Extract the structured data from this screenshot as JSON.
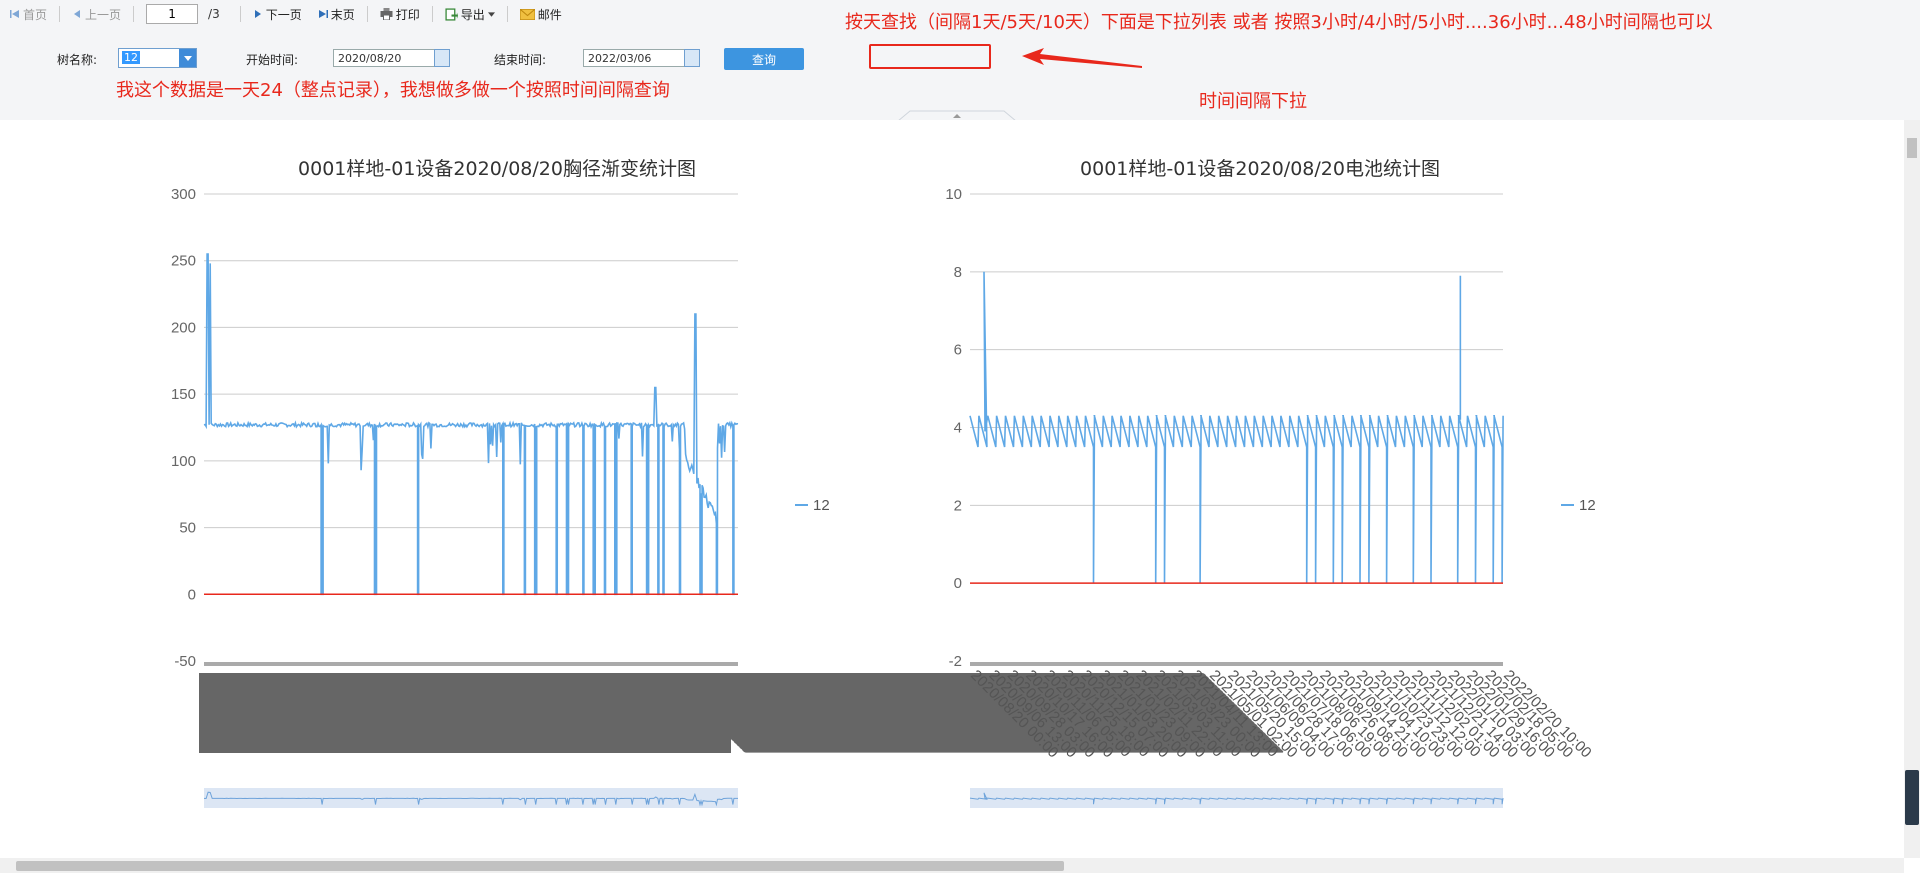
{
  "toolbar": {
    "first": "首页",
    "prev": "上一页",
    "page_value": "1",
    "page_total": "/3",
    "next": "下一页",
    "last": "末页",
    "print": "打印",
    "export": "导出",
    "mail": "邮件"
  },
  "query": {
    "tree_label": "树名称:",
    "tree_value": "12",
    "start_label": "开始时间:",
    "start_value": "2020/08/20",
    "end_label": "结束时间:",
    "end_value": "2022/03/06",
    "query_button": "查询"
  },
  "annotations": {
    "note_top": "按天查找（间隔1天/5天/10天）下面是下拉列表   或者 按照3小时/4小时/5小时....36小时...48小时间隔也可以",
    "note_left": "我这个数据是一天24（整点记录），我想做多做一个按照时间间隔查询",
    "note_right": "时间间隔下拉",
    "arrow_color": "#e8281c"
  },
  "chart_data": [
    {
      "type": "line",
      "title": "0001样地-01设备2020/08/20胸径渐变统计图",
      "ylim": [
        -50,
        300
      ],
      "y_ticks": [
        "300",
        "250",
        "200",
        "150",
        "100",
        "50",
        "0",
        "-50"
      ],
      "series": [
        {
          "name": "12",
          "color": "#5fa8e6"
        }
      ],
      "reference_line": {
        "y": 0,
        "color": "#e8281c"
      },
      "baseline_level": 127,
      "spikes": [
        255,
        248,
        210,
        155
      ],
      "legend": "right"
    },
    {
      "type": "line",
      "title": "0001样地-01设备2020/08/20电池统计图",
      "ylim": [
        -2,
        10
      ],
      "y_ticks": [
        "10",
        "8",
        "6",
        "4",
        "2",
        "0",
        "-2"
      ],
      "series": [
        {
          "name": "12",
          "color": "#5fa8e6"
        }
      ],
      "reference_line": {
        "y": 0,
        "color": "#e8281c"
      },
      "baseline_level": 4,
      "spikes": [
        8,
        7.9
      ],
      "x_ticks": [
        "2020/08/20 00:00",
        "2020/09/06 13:00",
        "2020/09/28 03:00",
        "2020/10/17 16:00",
        "2020/11/06 05:00",
        "2020/11/25 18:00",
        "2020/12/15 07:00",
        "2021/01/03 20:00",
        "2021/01/23 09:00",
        "2021/02/11 22:00",
        "2021/03/03 11:00",
        "2021/03/23 00:00",
        "2021/04/11 13:00",
        "2021/05/01 02:00",
        "2021/05/20 15:00",
        "2021/06/09 04:00",
        "2021/06/28 17:00",
        "2021/07/18 06:00",
        "2021/08/06 19:00",
        "2021/08/26 08:00",
        "2021/09/14 21:00",
        "2021/10/04 10:00",
        "2021/10/23 23:00",
        "2021/11/12 12:00",
        "2021/12/02 01:00",
        "2021/12/21 14:00",
        "2022/01/10 03:00",
        "2022/01/29 16:00",
        "2022/02/18 05:00",
        "2022/02/20 10:00"
      ],
      "legend": "right"
    }
  ]
}
